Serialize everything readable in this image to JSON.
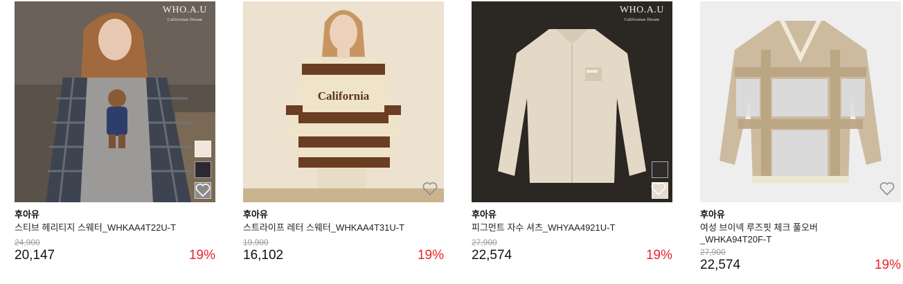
{
  "products": [
    {
      "brand": "후아유",
      "name": "스티브 헤리티지 스웨터_WHKAA4T22U-T",
      "original_price": "24,900",
      "price": "20,147",
      "discount": "19%",
      "image": "model-in-grey-teddy-sweater-with-plaid-jacket",
      "logo": "WHO.A.U",
      "logo_sub": "Californian Dream",
      "swatches": [
        "#efe7dc",
        "#2c2a30",
        "#8b8b8b"
      ]
    },
    {
      "brand": "후아유",
      "name": "스트라이프 레터 스웨터_WHKAA4T31U-T",
      "original_price": "19,900",
      "price": "16,102",
      "discount": "19%",
      "image": "model-in-brown-cream-striped-california-sweater"
    },
    {
      "brand": "후아유",
      "name": "피그먼트 자수 셔츠_WHYAA4921U-T",
      "original_price": "27,900",
      "price": "22,574",
      "discount": "19%",
      "image": "beige-long-sleeve-shirt-on-dark-background",
      "logo": "WHO.A.U",
      "logo_sub": "Californian Dream",
      "swatches": [
        "#2f2c2d",
        "#e5dccd"
      ]
    },
    {
      "brand": "후아유",
      "name": "여성 브이넥 루즈핏 체크 풀오버",
      "name_line2": "_WHKA94T20F-T",
      "original_price": "27,900",
      "price": "22,574",
      "discount": "19%",
      "image": "beige-plaid-v-neck-pullover-on-light-background"
    }
  ],
  "colors": {
    "discount": "#e8232d",
    "strike": "#9a9a9a"
  },
  "icons": {
    "wishlist": "heart-outline-icon"
  }
}
